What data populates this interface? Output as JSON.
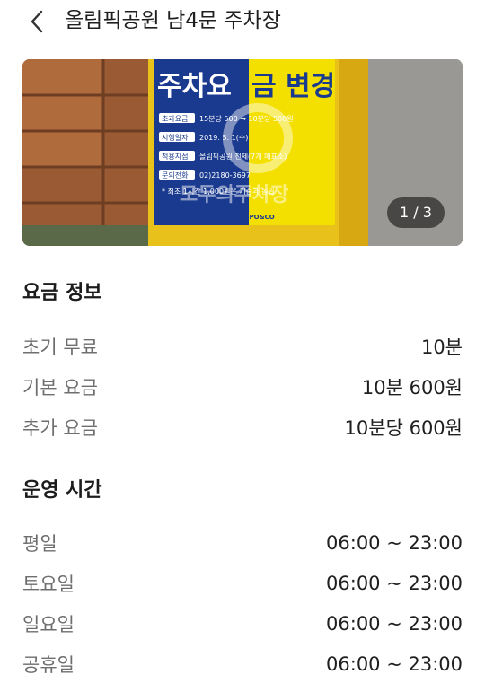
{
  "header": {
    "back_icon": "chevron-left-icon",
    "title": "올림픽공원 남4문 주차장"
  },
  "photo": {
    "sign_title": "주차요금 변경",
    "sign_lines": [
      {
        "tag": "초과요금",
        "text": "15분당 500 → 10분당 500원"
      },
      {
        "tag": "시행일자",
        "text": "2019. 5. 1(수)"
      },
      {
        "tag": "적용지점",
        "text": "올림픽공원 전체(7개 매표소)"
      },
      {
        "tag": "문의전화",
        "text": "02)2180-3697"
      }
    ],
    "sign_note": "* 최초 1시간 1,000원은 기존과 동일",
    "sign_logo": "KSPO&CO",
    "watermark": "모두의주차장",
    "pager": "1 / 3",
    "colors": {
      "blue": "#1a3a8f",
      "yellow": "#f3e000"
    }
  },
  "fee": {
    "title": "요금 정보",
    "rows": [
      {
        "label": "초기 무료",
        "value": "10분"
      },
      {
        "label": "기본 요금",
        "value": "10분 600원"
      },
      {
        "label": "추가 요금",
        "value": "10분당 600원"
      }
    ]
  },
  "hours": {
    "title": "운영 시간",
    "rows": [
      {
        "label": "평일",
        "value": "06:00 ~ 23:00"
      },
      {
        "label": "토요일",
        "value": "06:00 ~ 23:00"
      },
      {
        "label": "일요일",
        "value": "06:00 ~ 23:00"
      },
      {
        "label": "공휴일",
        "value": "06:00 ~ 23:00"
      }
    ]
  }
}
